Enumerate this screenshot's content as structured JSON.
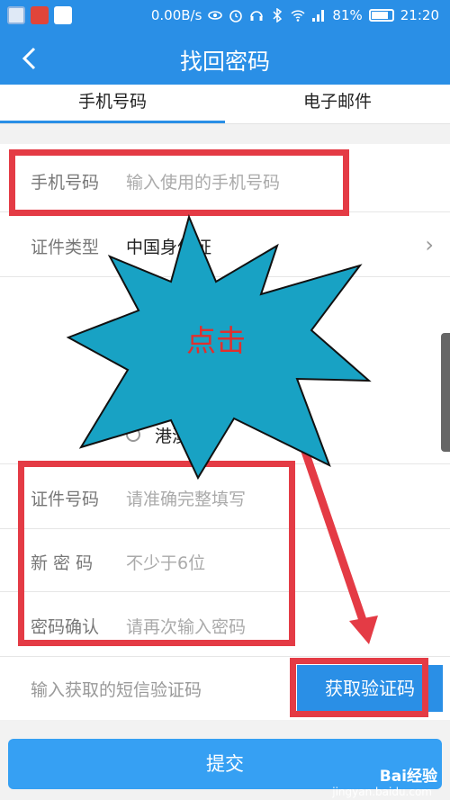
{
  "status_bar": {
    "speed": "0.00B/s",
    "battery": "81%",
    "time": "21:20"
  },
  "header": {
    "title": "找回密码"
  },
  "tabs": [
    {
      "label": "手机号码",
      "active": true
    },
    {
      "label": "电子邮件",
      "active": false
    }
  ],
  "form": {
    "phone": {
      "label": "手机号码",
      "placeholder": "输入使用的手机号码"
    },
    "id_type": {
      "label": "证件类型",
      "value": "中国身份证"
    },
    "radio_option": {
      "label": "港澳"
    },
    "id_number": {
      "label": "证件号码",
      "placeholder": "请准确完整填写"
    },
    "new_password": {
      "label": "新 密 码",
      "placeholder": "不少于6位"
    },
    "confirm_password": {
      "label": "密码确认",
      "placeholder": "请再次输入密码"
    },
    "sms_code": {
      "placeholder": "输入获取的短信验证码"
    },
    "get_code_label": "获取验证码",
    "submit_label": "提交"
  },
  "annotation": {
    "callout_text": "点击"
  },
  "watermark": {
    "brand": "Bai经验",
    "url": "jingyan.baidu.com"
  },
  "colors": {
    "primary": "#2a8fe6",
    "annotation_red": "#e43b45",
    "starburst": "#18a2c4"
  }
}
